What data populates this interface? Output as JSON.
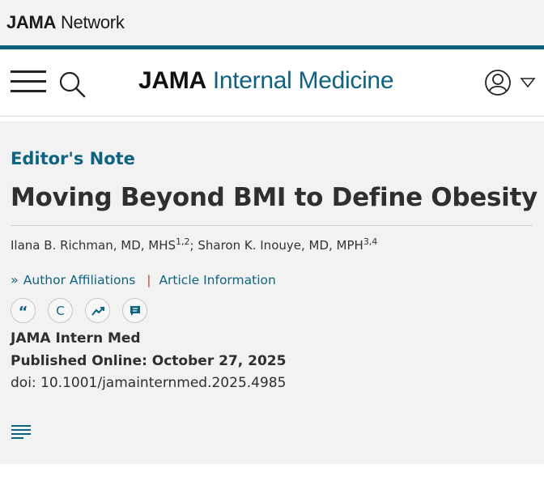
{
  "network": {
    "bold": "JAMA",
    "rest": " Network"
  },
  "brand": {
    "part1": "JAMA",
    "part2": " Internal Medicine"
  },
  "icons": {
    "menu": "hamburger-icon",
    "search": "search-icon",
    "user": "user-icon",
    "caret": "caret-down-icon",
    "cite": "quote-icon",
    "permissions": "copyright-icon",
    "metrics": "trend-icon",
    "comment": "comment-icon",
    "toc": "table-of-contents-icon"
  },
  "colors": {
    "brand_teal": "#0e6380",
    "separator": "#c0392b",
    "background": "#f2f2f2"
  },
  "article": {
    "kicker": "Editor's Note",
    "title": "Moving Beyond BMI to Define Obesity",
    "author1": "Ilana B. Richman, MD, MHS",
    "author1_sup": "1,2",
    "author_sep": "; ",
    "author2": "Sharon K. Inouye, MD, MPH",
    "author2_sup": "3,4",
    "links": {
      "affiliations": "Author Affiliations",
      "separator": "|",
      "info": "Article Information"
    },
    "tools": {
      "cite": "“",
      "permissions": "C"
    },
    "journal": "JAMA Intern Med",
    "published": "Published Online: October 27, 2025",
    "doi": "doi: 10.1001/jamainternmed.2025.4985"
  }
}
